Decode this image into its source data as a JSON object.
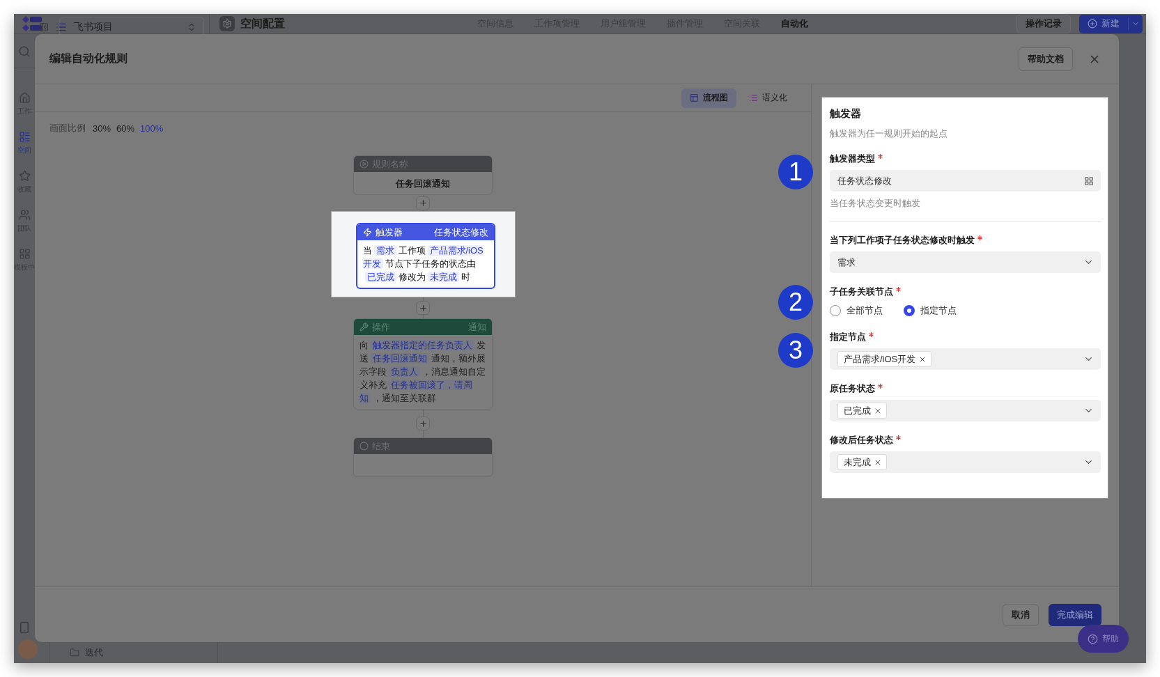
{
  "top_bar": {
    "project": "飞书项目",
    "page_title": "空间配置",
    "nav_tabs": [
      {
        "label": "空间信息",
        "selected": false
      },
      {
        "label": "工作项管理",
        "selected": false
      },
      {
        "label": "用户组管理",
        "selected": false
      },
      {
        "label": "插件管理",
        "selected": false
      },
      {
        "label": "空间关联",
        "selected": false
      },
      {
        "label": "自动化",
        "selected": true
      }
    ],
    "history_button": "操作记录",
    "new_button": "新建"
  },
  "sidebar": {
    "items": [
      {
        "label": "工作",
        "selected": false
      },
      {
        "label": "空间",
        "selected": true
      },
      {
        "label": "收藏",
        "selected": false
      },
      {
        "label": "团队",
        "selected": false
      },
      {
        "label": "模板中",
        "selected": false
      }
    ]
  },
  "background_list": {
    "item": "迭代"
  },
  "dialog": {
    "title": "编辑自动化规则",
    "help_doc_button": "帮助文档",
    "view_tabs": [
      {
        "label": "流程图",
        "selected": true
      },
      {
        "label": "语义化",
        "selected": false
      }
    ],
    "zoom": {
      "label": "画面比例",
      "options": [
        {
          "label": "30%",
          "selected": false
        },
        {
          "label": "60%",
          "selected": false
        },
        {
          "label": "100%",
          "selected": true
        }
      ]
    },
    "flow_nodes": [
      {
        "kind": "name",
        "title": "规则名称",
        "selected": false,
        "body": [
          {
            "text": "任务回滚通知",
            "token": false
          }
        ]
      },
      {
        "kind": "trigger",
        "title": "触发器",
        "tag": "任务状态修改",
        "selected": true,
        "body": [
          {
            "text": "当",
            "token": false
          },
          {
            "text": "需求",
            "token": true
          },
          {
            "text": "工作项",
            "token": false
          },
          {
            "text": "产品需求/iOS开发",
            "token": true
          },
          {
            "text": "节点下子任务的状态由",
            "token": false
          },
          {
            "text": "已完成",
            "token": true
          },
          {
            "text": "修改为",
            "token": false
          },
          {
            "text": "未完成",
            "token": true
          },
          {
            "text": "时",
            "token": false
          }
        ]
      },
      {
        "kind": "action",
        "title": "操作",
        "tag": "通知",
        "selected": false,
        "body": [
          {
            "text": "向",
            "token": false
          },
          {
            "text": "触发器指定的任务负责人",
            "token": true
          },
          {
            "text": "发送",
            "token": false
          },
          {
            "text": "任务回滚通知",
            "token": true
          },
          {
            "text": "通知，额外展示字段",
            "token": false
          },
          {
            "text": "负责人",
            "token": true
          },
          {
            "text": "，消息通知自定义补充",
            "token": false
          },
          {
            "text": "任务被回滚了，请周知",
            "token": true
          },
          {
            "text": "，通知至关联群",
            "token": false
          }
        ]
      },
      {
        "kind": "end",
        "title": "结束",
        "selected": false
      }
    ],
    "panel": {
      "title": "触发器",
      "description": "触发器为任一规则开始的起点",
      "fields": [
        {
          "kind": "picker",
          "label": "触发器类型",
          "required": true,
          "value": "任务状态修改",
          "hint": "当任务状态变更时触发",
          "callout": "1"
        },
        {
          "kind": "select",
          "label": "当下列工作项子任务状态修改时触发",
          "required": true,
          "value": "需求"
        },
        {
          "kind": "radio",
          "label": "子任务关联节点",
          "required": true,
          "callout": "2",
          "options": [
            {
              "label": "全部节点",
              "selected": false
            },
            {
              "label": "指定节点",
              "selected": true
            }
          ]
        },
        {
          "kind": "tags",
          "label": "指定节点",
          "required": true,
          "callout": "3",
          "tags": [
            "产品需求/iOS开发"
          ]
        },
        {
          "kind": "tags",
          "label": "原任务状态",
          "required": true,
          "tags": [
            "已完成"
          ]
        },
        {
          "kind": "tags",
          "label": "修改后任务状态",
          "required": true,
          "tags": [
            "未完成"
          ]
        }
      ]
    },
    "footer": {
      "cancel": "取消",
      "confirm": "完成编辑"
    }
  },
  "help_button": "帮助"
}
